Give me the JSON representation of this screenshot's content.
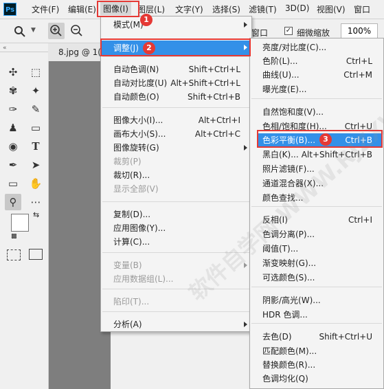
{
  "app": {
    "logo": "Ps"
  },
  "menubar": {
    "file": "文件(F)",
    "edit": "编辑(E)",
    "image": "图像(I)",
    "layer": "图层(L)",
    "type": "文字(Y)",
    "select": "选择(S)",
    "filter": "滤镜(T)",
    "threed": "3D(D)",
    "view": "视图(V)",
    "window": "窗口"
  },
  "options": {
    "window_label": "窗口",
    "scrubby_zoom_label": "细微缩放",
    "scrubby_zoom_checked": true,
    "zoom_value": "100%"
  },
  "document": {
    "tab_label": "8.jpg @ 1("
  },
  "image_menu": [
    {
      "label": "模式(M)",
      "submenu": true
    },
    {
      "label": "调整(J)",
      "submenu": true,
      "highlighted": true
    },
    {
      "label": "自动色调(N)",
      "shortcut": "Shift+Ctrl+L"
    },
    {
      "label": "自动对比度(U)",
      "shortcut": "Alt+Shift+Ctrl+L"
    },
    {
      "label": "自动颜色(O)",
      "shortcut": "Shift+Ctrl+B"
    },
    {
      "label": "图像大小(I)...",
      "shortcut": "Alt+Ctrl+I"
    },
    {
      "label": "画布大小(S)...",
      "shortcut": "Alt+Ctrl+C"
    },
    {
      "label": "图像旋转(G)",
      "submenu": true
    },
    {
      "label": "裁剪(P)",
      "disabled": true
    },
    {
      "label": "裁切(R)..."
    },
    {
      "label": "显示全部(V)",
      "disabled": true
    },
    {
      "label": "复制(D)..."
    },
    {
      "label": "应用图像(Y)..."
    },
    {
      "label": "计算(C)..."
    },
    {
      "label": "变量(B)",
      "submenu": true,
      "disabled": true
    },
    {
      "label": "应用数据组(L)...",
      "disabled": true
    },
    {
      "label": "陷印(T)...",
      "disabled": true
    },
    {
      "label": "分析(A)",
      "submenu": true
    }
  ],
  "adjust_menu": [
    {
      "label": "亮度/对比度(C)..."
    },
    {
      "label": "色阶(L)...",
      "shortcut": "Ctrl+L"
    },
    {
      "label": "曲线(U)...",
      "shortcut": "Ctrl+M"
    },
    {
      "label": "曝光度(E)..."
    },
    {
      "label": "自然饱和度(V)..."
    },
    {
      "label": "色相/饱和度(H)...",
      "shortcut": "Ctrl+U"
    },
    {
      "label": "色彩平衡(B)...",
      "shortcut": "Ctrl+B",
      "highlighted": true
    },
    {
      "label": "黑白(K)...",
      "shortcut": "Alt+Shift+Ctrl+B"
    },
    {
      "label": "照片滤镜(F)..."
    },
    {
      "label": "通道混合器(X)..."
    },
    {
      "label": "颜色查找..."
    },
    {
      "label": "反相(I)",
      "shortcut": "Ctrl+I"
    },
    {
      "label": "色调分离(P)..."
    },
    {
      "label": "阈值(T)..."
    },
    {
      "label": "渐变映射(G)..."
    },
    {
      "label": "可选颜色(S)..."
    },
    {
      "label": "阴影/高光(W)..."
    },
    {
      "label": "HDR 色调..."
    },
    {
      "label": "去色(D)",
      "shortcut": "Shift+Ctrl+U"
    },
    {
      "label": "匹配颜色(M)..."
    },
    {
      "label": "替换颜色(R)..."
    },
    {
      "label": "色调均化(Q)"
    }
  ],
  "callouts": {
    "step1": "1",
    "step2": "2",
    "step3": "3"
  },
  "watermark": "软件自学网 WWW.RJZXW.COM",
  "colors": {
    "highlight": "#3390e8",
    "callout": "#e53935",
    "canvas": "#7e7e7e"
  }
}
